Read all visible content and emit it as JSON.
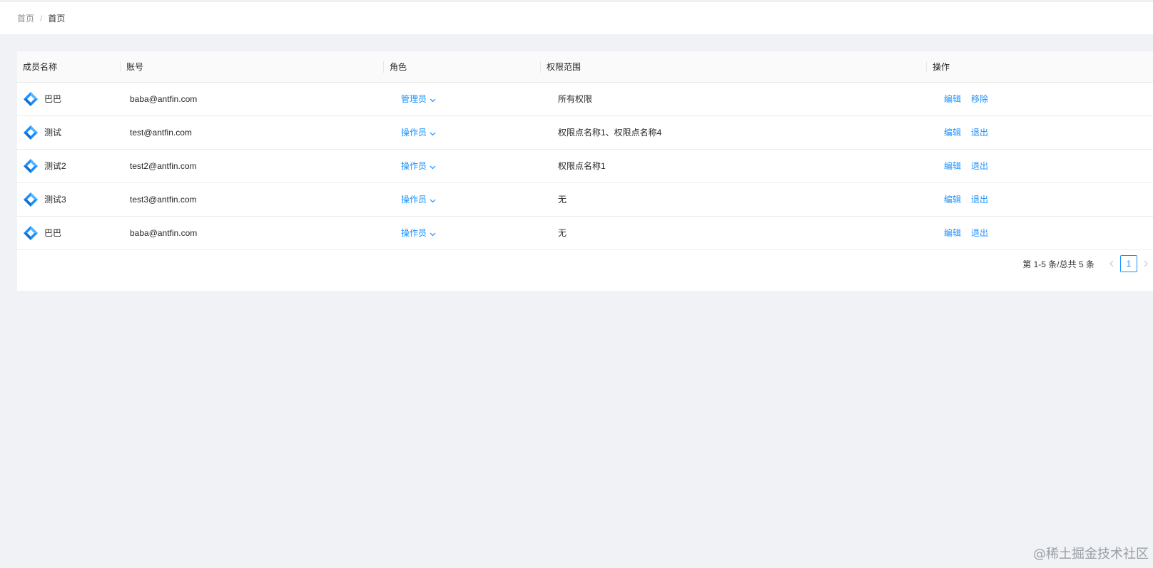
{
  "breadcrumb": {
    "items": [
      "首页",
      "首页"
    ],
    "separator": "/"
  },
  "table": {
    "columns": [
      "成员名称",
      "账号",
      "角色",
      "权限范围",
      "操作"
    ],
    "rows": [
      {
        "name": "巴巴",
        "account": "baba@antfin.com",
        "role": "管理员",
        "scope": "所有权限",
        "actions": [
          "编辑",
          "移除"
        ]
      },
      {
        "name": "测试",
        "account": "test@antfin.com",
        "role": "操作员",
        "scope": "权限点名称1、权限点名称4",
        "actions": [
          "编辑",
          "退出"
        ]
      },
      {
        "name": "测试2",
        "account": "test2@antfin.com",
        "role": "操作员",
        "scope": "权限点名称1",
        "actions": [
          "编辑",
          "退出"
        ]
      },
      {
        "name": "测试3",
        "account": "test3@antfin.com",
        "role": "操作员",
        "scope": "无",
        "actions": [
          "编辑",
          "退出"
        ]
      },
      {
        "name": "巴巴",
        "account": "baba@antfin.com",
        "role": "操作员",
        "scope": "无",
        "actions": [
          "编辑",
          "退出"
        ]
      }
    ]
  },
  "pagination": {
    "total_text": "第 1-5 条/总共 5 条",
    "current_page": "1"
  },
  "watermark": "@稀土掘金技术社区",
  "colors": {
    "link": "#1890ff",
    "background": "#f0f2f5",
    "header_bg": "#fafafa"
  },
  "icons": {
    "avatar": "diamond-logo-icon",
    "role_dropdown": "chevron-down-icon",
    "prev": "chevron-left-icon",
    "next": "chevron-right-icon"
  }
}
